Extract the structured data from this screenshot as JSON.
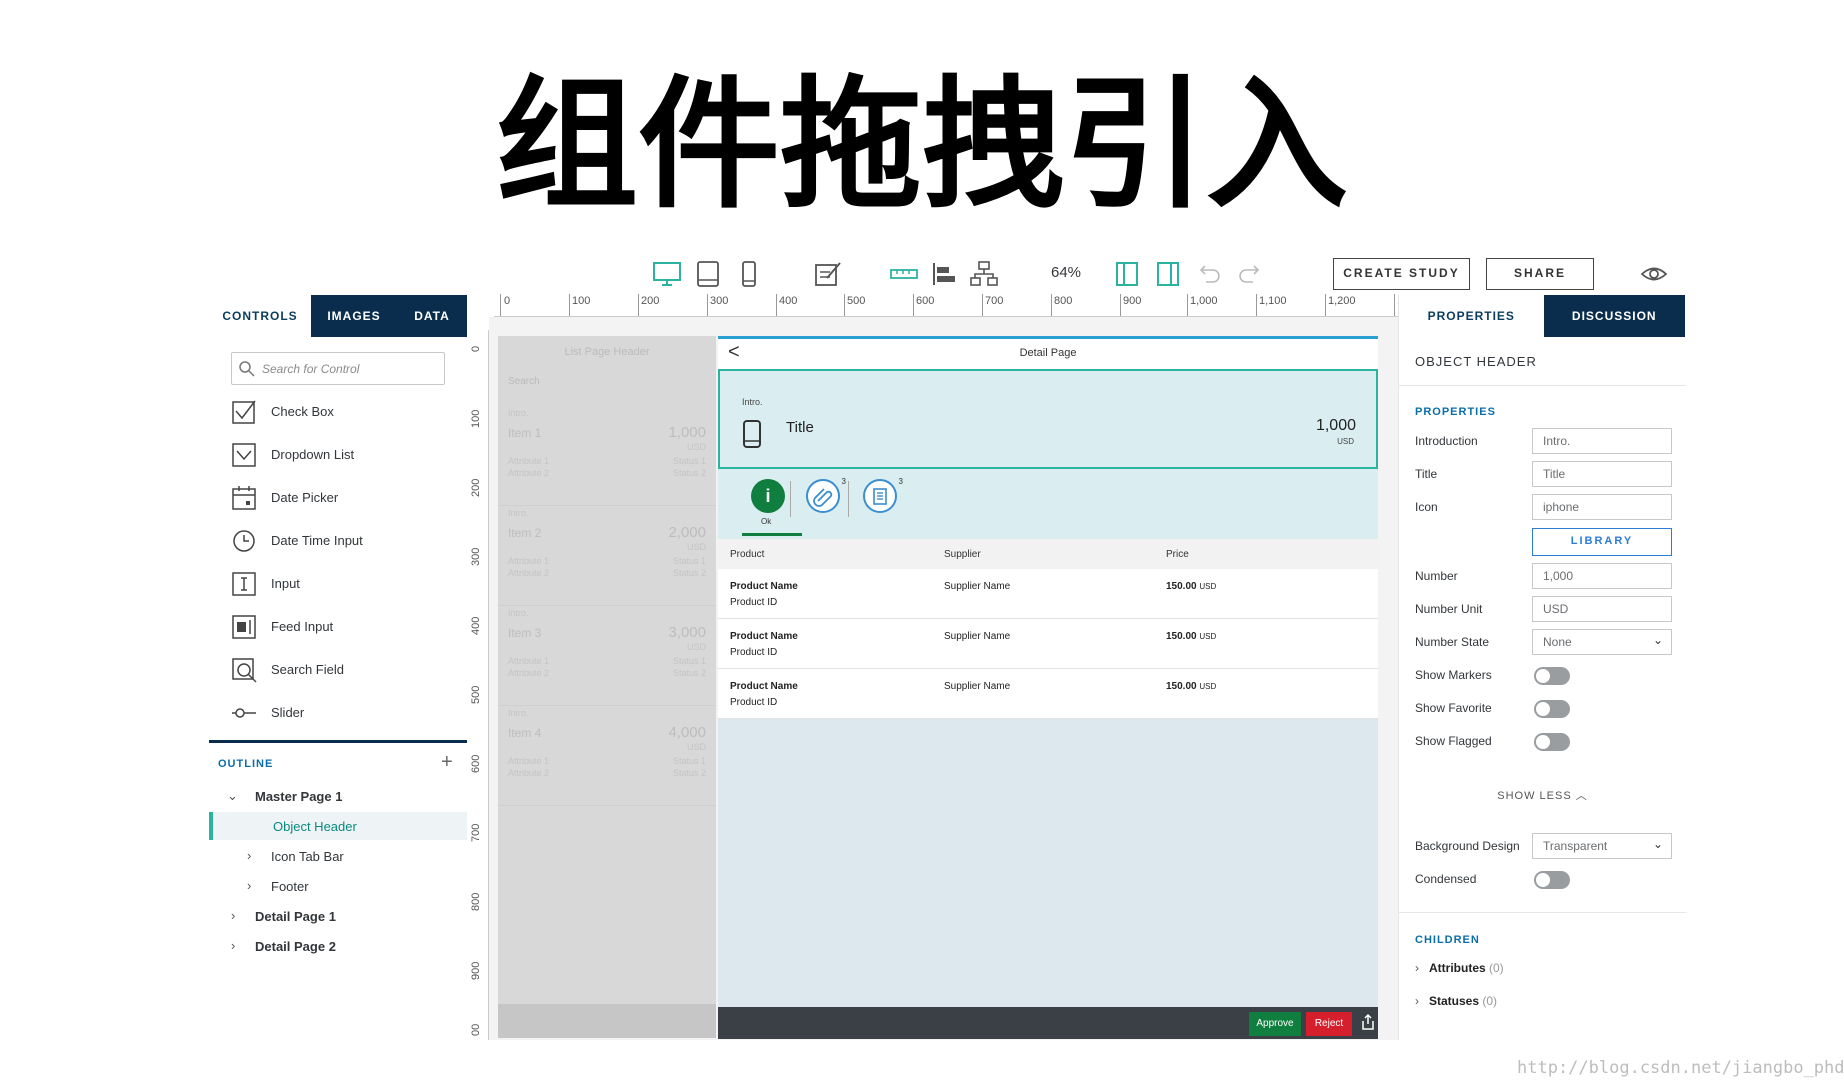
{
  "slide_title": "组件拖拽引入",
  "toolbar": {
    "zoom": "64%",
    "create_study": "CREATE STUDY",
    "share": "SHARE",
    "icons": [
      "desktop-icon",
      "tablet-icon",
      "phone-icon",
      "edit-note-icon",
      "ruler-icon",
      "align-left-icon",
      "hierarchy-icon",
      "panel-left-icon",
      "panel-right-icon",
      "undo-icon",
      "redo-icon",
      "eye-icon"
    ]
  },
  "left_panel": {
    "tabs": [
      "CONTROLS",
      "IMAGES",
      "DATA"
    ],
    "search_placeholder": "Search for Control",
    "controls": [
      "Check Box",
      "Dropdown List",
      "Date Picker",
      "Date Time Input",
      "Input",
      "Feed Input",
      "Search Field",
      "Slider"
    ],
    "outline_title": "OUTLINE",
    "outline_add": "+",
    "outline": [
      {
        "label": "Master Page 1",
        "chev": "⌄"
      },
      {
        "label": "Object Header",
        "chev": ""
      },
      {
        "label": "Icon Tab Bar",
        "chev": "›"
      },
      {
        "label": "Footer",
        "chev": "›"
      },
      {
        "label": "Detail Page 1",
        "chev": "›"
      },
      {
        "label": "Detail Page 2",
        "chev": "›"
      }
    ]
  },
  "ruler": {
    "top": [
      "0",
      "100",
      "200",
      "300",
      "400",
      "500",
      "600",
      "700",
      "800",
      "900",
      "1,000",
      "1,100",
      "1,200",
      "1"
    ],
    "left": [
      "0",
      "100",
      "200",
      "300",
      "400",
      "500",
      "600",
      "700",
      "800",
      "900",
      "00"
    ]
  },
  "list_page": {
    "header": "List Page Header",
    "search": "Search",
    "items": [
      {
        "intro": "Intro.",
        "title": "Item 1",
        "number": "1,000",
        "unit": "USD",
        "attr1": "Attribute 1",
        "attr2": "Attribute 2",
        "status1": "Status 1",
        "status2": "Status 2"
      },
      {
        "intro": "Intro.",
        "title": "Item 2",
        "number": "2,000",
        "unit": "USD",
        "attr1": "Attribute 1",
        "attr2": "Attribute 2",
        "status1": "Status 1",
        "status2": "Status 2"
      },
      {
        "intro": "Intro.",
        "title": "Item 3",
        "number": "3,000",
        "unit": "USD",
        "attr1": "Attribute 1",
        "attr2": "Attribute 2",
        "status1": "Status 1",
        "status2": "Status 2"
      },
      {
        "intro": "Intro.",
        "title": "Item 4",
        "number": "4,000",
        "unit": "USD",
        "attr1": "Attribute 1",
        "attr2": "Attribute 2",
        "status1": "Status 1",
        "status2": "Status 2"
      }
    ]
  },
  "detail_page": {
    "back": "<",
    "title": "Detail Page",
    "object_header": {
      "intro": "Intro.",
      "title": "Title",
      "number": "1,000",
      "unit": "USD"
    },
    "icon_tabs": [
      {
        "icon": "info-icon",
        "glyph": "i",
        "label": "Ok",
        "count": ""
      },
      {
        "icon": "attachment-icon",
        "count": "3"
      },
      {
        "icon": "notes-icon",
        "count": "3"
      }
    ],
    "table_headers": [
      "Product",
      "Supplier",
      "Price"
    ],
    "rows": [
      {
        "name": "Product Name",
        "id": "Product ID",
        "supplier": "Supplier Name",
        "price": "150.00",
        "currency": "USD"
      },
      {
        "name": "Product Name",
        "id": "Product ID",
        "supplier": "Supplier Name",
        "price": "150.00",
        "currency": "USD"
      },
      {
        "name": "Product Name",
        "id": "Product ID",
        "supplier": "Supplier Name",
        "price": "150.00",
        "currency": "USD"
      }
    ],
    "footer": {
      "approve": "Approve",
      "reject": "Reject"
    }
  },
  "right_panel": {
    "tabs": [
      "PROPERTIES",
      "DISCUSSION"
    ],
    "object_title": "OBJECT HEADER",
    "section_properties": "PROPERTIES",
    "introduction": {
      "label": "Introduction",
      "value": "Intro."
    },
    "title": {
      "label": "Title",
      "value": "Title"
    },
    "icon": {
      "label": "Icon",
      "value": "iphone"
    },
    "library": "LIBRARY",
    "number": {
      "label": "Number",
      "value": "1,000"
    },
    "number_unit": {
      "label": "Number Unit",
      "value": "USD"
    },
    "number_state": {
      "label": "Number State",
      "value": "None"
    },
    "show_markers": {
      "label": "Show Markers",
      "on": false
    },
    "show_favorite": {
      "label": "Show Favorite",
      "on": false
    },
    "show_flagged": {
      "label": "Show Flagged",
      "on": false
    },
    "show_less": "SHOW LESS ︿",
    "background_design": {
      "label": "Background Design",
      "value": "Transparent"
    },
    "condensed": {
      "label": "Condensed",
      "on": false
    },
    "section_children": "CHILDREN",
    "children": [
      {
        "label": "Attributes",
        "count": "(0)"
      },
      {
        "label": "Statuses",
        "count": "(0)"
      }
    ]
  },
  "watermark": "http://blog.csdn.net/jiangbo_phd",
  "colors": {
    "navy": "#0a2d4d",
    "teal": "#2bb3a0",
    "approve": "#107e3e",
    "reject": "#d61f2c",
    "link": "#0a6ea8"
  }
}
